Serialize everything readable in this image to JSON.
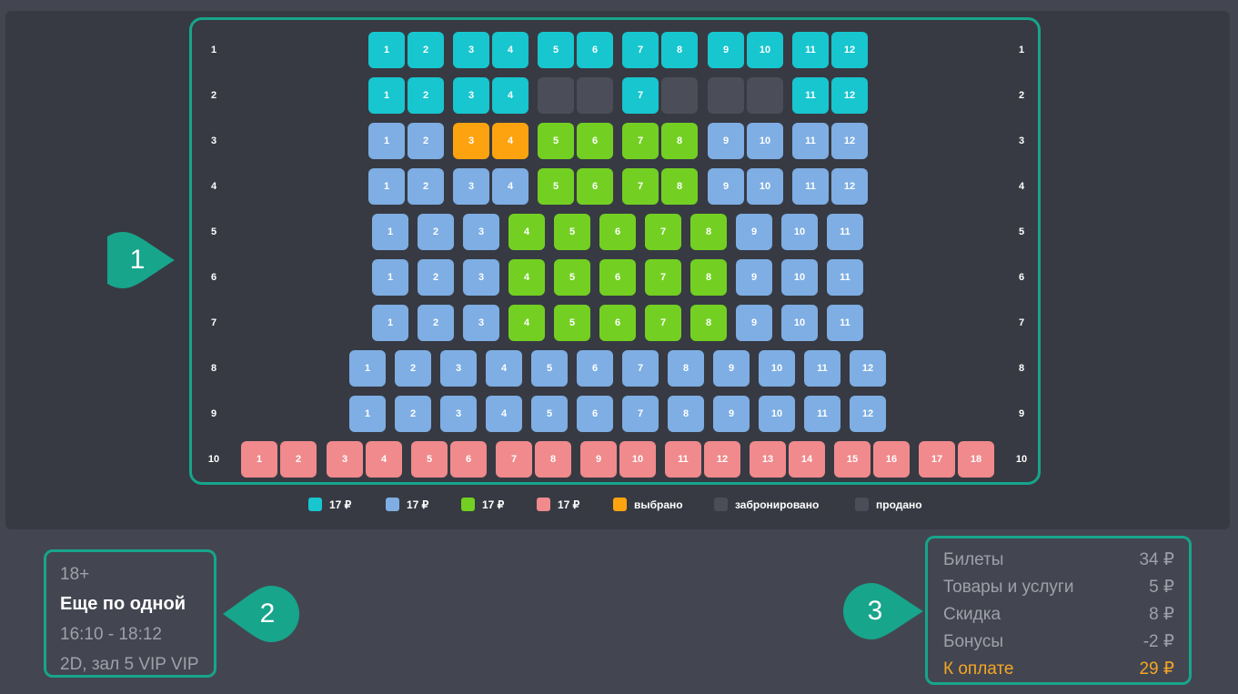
{
  "colors": {
    "teal": "#17c6cf",
    "blue": "#7eaee3",
    "green": "#73d022",
    "pink": "#f08a8c",
    "selected": "#fca30f",
    "reserved": "#4b4e58",
    "sold": "#4b4e58",
    "frame": "#17a58b",
    "panel": "#373a43"
  },
  "hall": {
    "rows": [
      {
        "number": "1",
        "seats": [
          "1",
          "2",
          "3",
          "4",
          "5",
          "6",
          "7",
          "8",
          "9",
          "10",
          "11",
          "12"
        ],
        "states": [
          "teal",
          "teal",
          "teal",
          "teal",
          "teal",
          "teal",
          "teal",
          "teal",
          "teal",
          "teal",
          "teal",
          "teal"
        ]
      },
      {
        "number": "2",
        "seats": [
          "1",
          "2",
          "3",
          "4",
          "",
          "",
          "7",
          "",
          "",
          "",
          "11",
          "12"
        ],
        "states": [
          "teal",
          "teal",
          "teal",
          "teal",
          "reserved",
          "reserved",
          "teal",
          "reserved",
          "reserved",
          "reserved",
          "teal",
          "teal"
        ]
      },
      {
        "number": "3",
        "seats": [
          "1",
          "2",
          "3",
          "4",
          "5",
          "6",
          "7",
          "8",
          "9",
          "10",
          "11",
          "12"
        ],
        "states": [
          "blue",
          "blue",
          "selected",
          "selected",
          "green",
          "green",
          "green",
          "green",
          "blue",
          "blue",
          "blue",
          "blue"
        ]
      },
      {
        "number": "4",
        "seats": [
          "1",
          "2",
          "3",
          "4",
          "5",
          "6",
          "7",
          "8",
          "9",
          "10",
          "11",
          "12"
        ],
        "states": [
          "blue",
          "blue",
          "blue",
          "blue",
          "green",
          "green",
          "green",
          "green",
          "blue",
          "blue",
          "blue",
          "blue"
        ]
      },
      {
        "number": "5",
        "seats": [
          "1",
          "2",
          "3",
          "4",
          "5",
          "6",
          "7",
          "8",
          "9",
          "10",
          "11"
        ],
        "states": [
          "blue",
          "blue",
          "blue",
          "green",
          "green",
          "green",
          "green",
          "green",
          "blue",
          "blue",
          "blue"
        ]
      },
      {
        "number": "6",
        "seats": [
          "1",
          "2",
          "3",
          "4",
          "5",
          "6",
          "7",
          "8",
          "9",
          "10",
          "11"
        ],
        "states": [
          "blue",
          "blue",
          "blue",
          "green",
          "green",
          "green",
          "green",
          "green",
          "blue",
          "blue",
          "blue"
        ]
      },
      {
        "number": "7",
        "seats": [
          "1",
          "2",
          "3",
          "4",
          "5",
          "6",
          "7",
          "8",
          "9",
          "10",
          "11"
        ],
        "states": [
          "blue",
          "blue",
          "blue",
          "green",
          "green",
          "green",
          "green",
          "green",
          "blue",
          "blue",
          "blue"
        ]
      },
      {
        "number": "8",
        "seats": [
          "1",
          "2",
          "3",
          "4",
          "5",
          "6",
          "7",
          "8",
          "9",
          "10",
          "11",
          "12"
        ],
        "states": [
          "blue",
          "blue",
          "blue",
          "blue",
          "blue",
          "blue",
          "blue",
          "blue",
          "blue",
          "blue",
          "blue",
          "blue"
        ]
      },
      {
        "number": "9",
        "seats": [
          "1",
          "2",
          "3",
          "4",
          "5",
          "6",
          "7",
          "8",
          "9",
          "10",
          "11",
          "12"
        ],
        "states": [
          "blue",
          "blue",
          "blue",
          "blue",
          "blue",
          "blue",
          "blue",
          "blue",
          "blue",
          "blue",
          "blue",
          "blue"
        ]
      },
      {
        "number": "10",
        "seats": [
          "1",
          "2",
          "3",
          "4",
          "5",
          "6",
          "7",
          "8",
          "9",
          "10",
          "11",
          "12",
          "13",
          "14",
          "15",
          "16",
          "17",
          "18"
        ],
        "states": [
          "pink",
          "pink",
          "pink",
          "pink",
          "pink",
          "pink",
          "pink",
          "pink",
          "pink",
          "pink",
          "pink",
          "pink",
          "pink",
          "pink",
          "pink",
          "pink",
          "pink",
          "pink"
        ]
      }
    ]
  },
  "legend": [
    {
      "label": "17 ₽",
      "color": "teal"
    },
    {
      "label": "17 ₽",
      "color": "blue"
    },
    {
      "label": "17 ₽",
      "color": "green"
    },
    {
      "label": "17 ₽",
      "color": "pink"
    },
    {
      "label": "выбрано",
      "color": "selected"
    },
    {
      "label": "забронировано",
      "color": "reserved"
    },
    {
      "label": "продано",
      "color": "sold"
    }
  ],
  "callouts": [
    "1",
    "2",
    "3"
  ],
  "movie": {
    "age_rating": "18+",
    "title": "Еще по одной",
    "time": "16:10 - 18:12",
    "format_hall": "2D, зал 5 VIP VIP"
  },
  "summary": {
    "tickets_label": "Билеты",
    "tickets_value": "34 ₽",
    "goods_label": "Товары и услуги",
    "goods_value": "5 ₽",
    "discount_label": "Скидка",
    "discount_value": "8 ₽",
    "bonus_label": "Бонусы",
    "bonus_value": "-2 ₽",
    "total_label": "К оплате",
    "total_value": "29 ₽"
  }
}
